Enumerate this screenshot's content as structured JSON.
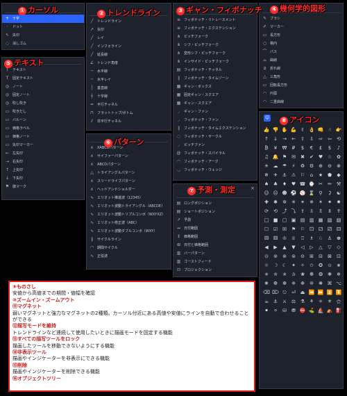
{
  "colors": {
    "panel_bg": "#1e222d",
    "accent": "#2962ff",
    "annotation": "#ff2a2a"
  },
  "sections": [
    {
      "id": "cursor",
      "num": "①",
      "title": "カーソル",
      "close": "",
      "items": [
        {
          "icon": "+",
          "label": "十字",
          "active": true
        },
        {
          "icon": "·",
          "label": "ドット"
        },
        {
          "icon": "↖",
          "label": "矢印"
        },
        {
          "icon": "◌",
          "label": "消しゴム"
        }
      ]
    },
    {
      "id": "trendline",
      "num": "②",
      "title": "トレンドライン",
      "close": "",
      "items": [
        {
          "icon": "╱",
          "label": "トレンドライン"
        },
        {
          "icon": "↗",
          "label": "矢印"
        },
        {
          "icon": "╱",
          "label": "レイ"
        },
        {
          "icon": "╱",
          "label": "インフォライン"
        },
        {
          "icon": "╱",
          "label": "延長線"
        },
        {
          "icon": "∠",
          "label": "トレンド角度"
        },
        {
          "icon": "─",
          "label": "水平線"
        },
        {
          "icon": "─",
          "label": "水平レイ"
        },
        {
          "icon": "│",
          "label": "垂直線"
        },
        {
          "icon": "┼",
          "label": "十字線"
        },
        {
          "icon": "═",
          "label": "平行チャネル"
        },
        {
          "icon": "⊓",
          "label": "フラットトップ/ボトム"
        },
        {
          "icon": "⫽",
          "label": "非平行チャネル"
        }
      ]
    },
    {
      "id": "gann",
      "num": "③",
      "title": "ギャン・フィボナッチ",
      "close": "",
      "items": [
        {
          "icon": "≡",
          "label": "フィボナッチ・リトレースメント"
        },
        {
          "icon": "≡",
          "label": "フィボナッチ・エクステンション"
        },
        {
          "icon": "⋔",
          "label": "ピッチフォーク"
        },
        {
          "icon": "⋔",
          "label": "シフ・ピッチフォーク"
        },
        {
          "icon": "⋔",
          "label": "変形シフ・ピッチフォーク"
        },
        {
          "icon": "⋔",
          "label": "インサイド・ピッチフォーク"
        },
        {
          "icon": "▤",
          "label": "フィボナッチ・チャネル"
        },
        {
          "icon": "∥",
          "label": "フィボナッチ・タイムゾーン"
        },
        {
          "icon": "▦",
          "label": "ギャン・ボックス"
        },
        {
          "icon": "▦",
          "label": "固定ギャン・スクエア"
        },
        {
          "icon": "▦",
          "label": "ギャン・スクエア"
        },
        {
          "icon": "◞",
          "label": "ギャン・ファン"
        },
        {
          "icon": "◞",
          "label": "フィボナッチ・ファン"
        },
        {
          "icon": "∥",
          "label": "フィボナッチ・タイムエクステンション"
        },
        {
          "icon": "◌",
          "label": "フィボナッチ・サークル"
        },
        {
          "icon": "◞",
          "label": "ピッチファン"
        },
        {
          "icon": "@",
          "label": "フィボナッチ・スパイラル"
        },
        {
          "icon": "◠",
          "label": "フィボナッチ・アーク"
        },
        {
          "icon": "◡",
          "label": "フィボナッチ・ウェッジ"
        }
      ]
    },
    {
      "id": "shapes",
      "num": "④",
      "title": "幾何学的図形",
      "close": "",
      "items": [
        {
          "icon": "✎",
          "label": "ブラシ"
        },
        {
          "icon": "✐",
          "label": "マーカー"
        },
        {
          "icon": "▭",
          "label": "長方形"
        },
        {
          "icon": "○",
          "label": "楕円"
        },
        {
          "icon": "⌒",
          "label": "パス"
        },
        {
          "icon": "⌓",
          "label": "曲線"
        },
        {
          "icon": "⧄",
          "label": "折れ線"
        },
        {
          "icon": "△",
          "label": "三角形"
        },
        {
          "icon": "▭",
          "label": "回転長方形"
        },
        {
          "icon": "◠",
          "label": "円弧"
        },
        {
          "icon": "◠",
          "label": "二重曲線"
        }
      ]
    },
    {
      "id": "text",
      "num": "⑤",
      "title": "テキスト",
      "close": "",
      "items": [
        {
          "icon": "T",
          "label": "テキスト"
        },
        {
          "icon": "T",
          "label": "固定テキスト"
        },
        {
          "icon": "◎",
          "label": "ノート"
        },
        {
          "icon": "◎",
          "label": "固定ノート"
        },
        {
          "icon": "◎",
          "label": "吹し吹き"
        },
        {
          "icon": "▭",
          "label": "吹きだし"
        },
        {
          "icon": "▭",
          "label": "バルーン"
        },
        {
          "icon": "▭",
          "label": "価格ラベル"
        },
        {
          "icon": "▭",
          "label": "価格ノート"
        },
        {
          "icon": "▭",
          "label": "矢印マーカー"
        },
        {
          "icon": "←",
          "label": "左矢印"
        },
        {
          "icon": "→",
          "label": "右矢印"
        },
        {
          "icon": "↑",
          "label": "上矢印"
        },
        {
          "icon": "↓",
          "label": "下矢印"
        },
        {
          "icon": "⚑",
          "label": "旗マーク"
        }
      ]
    },
    {
      "id": "pattern",
      "num": "⑥",
      "title": "パターン",
      "close": "",
      "items": [
        {
          "icon": "∧",
          "label": "XABCDパターン"
        },
        {
          "icon": "∧",
          "label": "サイファーパターン"
        },
        {
          "icon": "∧",
          "label": "ABCDパターン"
        },
        {
          "icon": "△",
          "label": "トライアングルパターン"
        },
        {
          "icon": "∧",
          "label": "スリードライブパターン"
        },
        {
          "icon": "∧",
          "label": "ヘッドアンドショルダー"
        },
        {
          "icon": "∿",
          "label": "エリオット推進波（12345）"
        },
        {
          "icon": "∿",
          "label": "エリオット波動トライアングル（ABCDE）"
        },
        {
          "icon": "∿",
          "label": "エリオット波動トリプルコンボ（WXYXZ）"
        },
        {
          "icon": "∿",
          "label": "エリオット修正波（ABC）"
        },
        {
          "icon": "∿",
          "label": "エリオット波動ダブルコンボ（WXY）"
        },
        {
          "icon": "∥",
          "label": "サイクルライン"
        },
        {
          "icon": "◠",
          "label": "期間サイクル"
        },
        {
          "icon": "∿",
          "label": "正弦波"
        }
      ]
    },
    {
      "id": "forecast",
      "num": "⑦",
      "title": "予測・測定",
      "close": "×",
      "items": [
        {
          "icon": "▤",
          "label": "ロングポジション"
        },
        {
          "icon": "▤",
          "label": "ショートポジション"
        },
        {
          "icon": "↗",
          "label": "予測"
        },
        {
          "icon": "↔",
          "label": "日付範囲"
        },
        {
          "icon": "↕",
          "label": "価格範囲"
        },
        {
          "icon": "⊞",
          "label": "日付と価格範囲"
        },
        {
          "icon": "▥",
          "label": "バーパターン"
        },
        {
          "icon": "▥",
          "label": "ゴーストフィード"
        },
        {
          "icon": "⊡",
          "label": "プロジェクション"
        }
      ]
    }
  ],
  "icons_panel": {
    "num": "⑧",
    "title": "アイコン",
    "selected": "☺",
    "glyphs": [
      "👍",
      "👎",
      "✋",
      "💪",
      "✌",
      "👌",
      "👊",
      "☝",
      "👉",
      "↑",
      "↓",
      "→",
      "←",
      "⇧",
      "⇩",
      "⇨",
      "⇦",
      "⟲",
      "₿",
      "¥",
      "₩",
      "₽",
      "$",
      "€",
      "£",
      "$",
      "♪",
      "♫",
      "🔔",
      "⚑",
      "✉",
      "✖",
      "✔",
      "♥",
      "☆",
      "✿",
      "☀",
      "☁",
      "☂",
      "⚡",
      "♻",
      "⚙",
      "⊕",
      "⊖",
      "⊗",
      "❄",
      "✈",
      "⚓",
      "⚠",
      "⚐",
      "⌂",
      "★",
      "⬟",
      "◆",
      "♠",
      "♣",
      "♦",
      "♥",
      "☎",
      "⌚",
      "✂",
      "✏",
      "⚒",
      "☺",
      "☹",
      "☻",
      "⚽",
      "⚾",
      "⌛",
      "⚲",
      "⚳",
      "☯",
      "✚",
      "✱",
      "✲",
      "✳",
      "✴",
      "✵",
      "✶",
      "✷",
      "✸",
      "⟳",
      "⟲",
      "⤴",
      "⤵",
      "⇪",
      "⇫",
      "⇬",
      "⇭",
      "⇮",
      "□",
      "■",
      "▢",
      "▣",
      "▤",
      "▥",
      "▦",
      "▧",
      "▨",
      "☐",
      "☑",
      "☒",
      "⚑",
      "⚐",
      "⚀",
      "⚁",
      "⚂",
      "⚃",
      "⚄",
      "⚅",
      "♔",
      "♕",
      "♖",
      "♗",
      "♘",
      "♙",
      "♚",
      "◀",
      "▶",
      "▲",
      "▼",
      "◁",
      "▷",
      "△",
      "▽",
      "◇",
      "⊙",
      "⊚",
      "⊛",
      "⊜",
      "⊝",
      "⊞",
      "⊟",
      "⊠",
      "⊡",
      "☼",
      "☽",
      "☾",
      "✦",
      "✧",
      "✩",
      "✪",
      "✫",
      "✬",
      "✭",
      "✮",
      "✯",
      "✰",
      "❀",
      "❁",
      "❂",
      "❃",
      "❄",
      "❅",
      "❆",
      "❇",
      "❈",
      "❉",
      "❊",
      "❋",
      "⌘",
      "⌥",
      "⌫",
      "⌦",
      "⎋",
      "⏎",
      "⏏",
      "⏪",
      "⏩",
      "⏫",
      "⏬",
      "☕",
      "⚓",
      "⚔",
      "⚖",
      "⚗",
      "⚘",
      "⚛",
      "⚜",
      "⚝",
      "⚫",
      "⚪",
      "⛁",
      "⛃",
      "⛔",
      "⛳",
      "⛵",
      "⛺",
      "⛽"
    ]
  },
  "notes": [
    {
      "num": "⑨",
      "title": "ものさし",
      "desc": "安値から高値までの期間・値幅を確認"
    },
    {
      "num": "⑩",
      "title": "ズームイン・ズームアウト",
      "desc": ""
    },
    {
      "num": "⑪",
      "title": "マグネット",
      "desc": "弱いマグネットと強力なマグネットの2種類。カーソル付近にある高値や安値にラインを自動で合わせることができる"
    },
    {
      "num": "⑫",
      "title": "描写モードを維持",
      "desc": "トレンドラインなど連続して使用したいときに描画モードを固定する機能"
    },
    {
      "num": "⑬",
      "title": "すべての描写ツールをロック",
      "desc": "描画したツールを移動できないようにする機能"
    },
    {
      "num": "⑭",
      "title": "非表示ツール",
      "desc": "描画やインジケーターを非表示にできる機能"
    },
    {
      "num": "⑮",
      "title": "削除",
      "desc": "描画やインジケーターを削除できる機能"
    },
    {
      "num": "⑯",
      "title": "オブジェクトツリー",
      "desc": ""
    }
  ]
}
